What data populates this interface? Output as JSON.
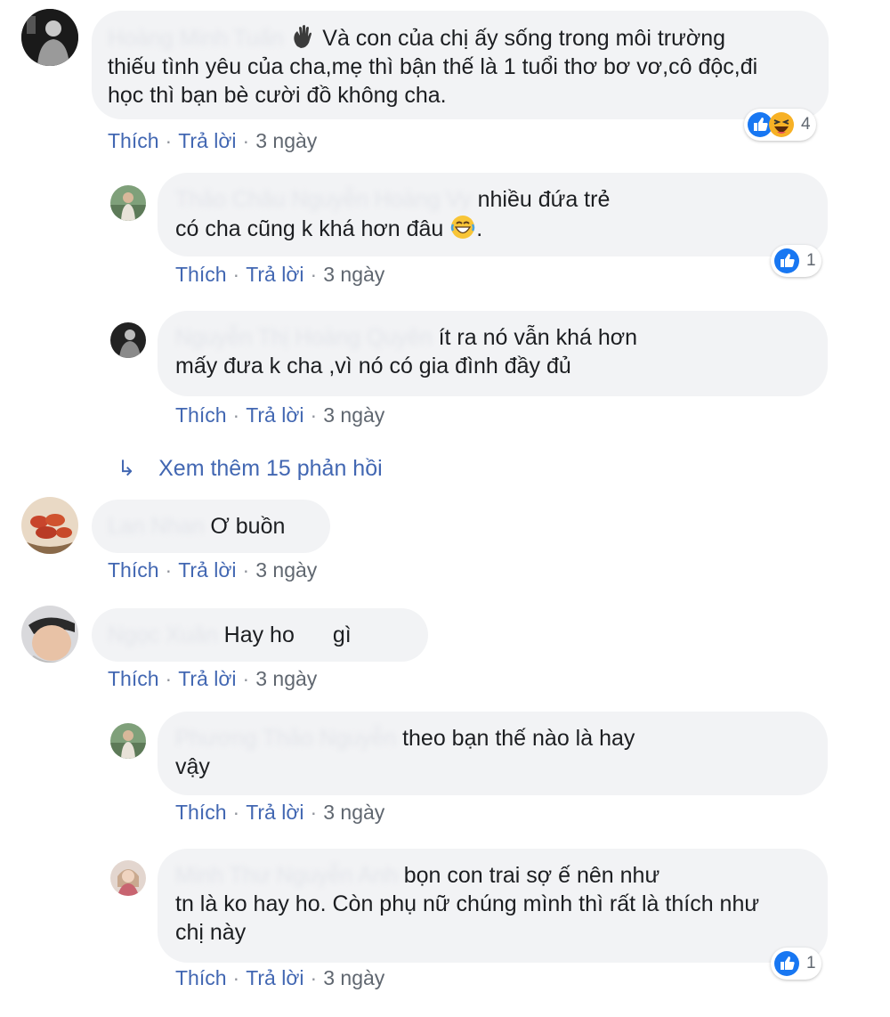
{
  "comments": [
    {
      "id": "c1",
      "author": "Hoàng Minh Tuấn",
      "lines": [
        "Và con của chị ấy sống trong môi trường",
        "thiếu tình yêu của cha,mẹ thì bận thế là 1 tuổi thơ bơ vơ,cô độc,đi",
        "học thì bạn bè cười đồ không cha."
      ],
      "like_label": "Thích",
      "reply_label": "Trả lời",
      "time": "3 ngày",
      "reactions": [
        "like-icon",
        "haha-icon"
      ],
      "reaction_count": "4"
    },
    {
      "id": "c1r1",
      "author": "Thảo Châu Nguyễn Hoàng Vy",
      "lines": [
        "nhiều đứa trẻ",
        "có cha cũng k khá hơn đâu",
        "."
      ],
      "like_label": "Thích",
      "reply_label": "Trả lời",
      "time": "3 ngày",
      "reactions": [
        "like-icon"
      ],
      "reaction_count": "1"
    },
    {
      "id": "c1r2",
      "author": "Nguyễn Thị Hoàng Quyên",
      "lines": [
        "ít ra nó vẫn khá hơn",
        "mấy đưa k cha ,vì nó có gia đình đầy đủ"
      ],
      "like_label": "Thích",
      "reply_label": "Trả lời",
      "time": "3 ngày"
    },
    {
      "id": "c2",
      "author": "Lan Nhan",
      "lines": [
        "Ơ buồn"
      ],
      "like_label": "Thích",
      "reply_label": "Trả lời",
      "time": "3 ngày"
    },
    {
      "id": "c3",
      "author": "Ngọc Xuân",
      "lines": [
        "Hay ho",
        "gì"
      ],
      "like_label": "Thích",
      "reply_label": "Trả lời",
      "time": "3 ngày"
    },
    {
      "id": "c3r1",
      "author": "Phương Thảo Nguyễn",
      "lines": [
        "theo bạn thế nào là hay",
        "vậy"
      ],
      "like_label": "Thích",
      "reply_label": "Trả lời",
      "time": "3 ngày"
    },
    {
      "id": "c3r2",
      "author": "Minh Thư Nguyễn Anh",
      "lines": [
        "bọn con trai sợ ế nên như",
        "tn là ko hay ho. Còn phụ nữ chúng mình thì rất là thích như",
        "chị này"
      ],
      "like_label": "Thích",
      "reply_label": "Trả lời",
      "time": "3 ngày",
      "reactions": [
        "like-icon"
      ],
      "reaction_count": "1"
    }
  ],
  "view_more": {
    "label": "Xem thêm 15 phản hồi",
    "icon": "reply-arrow-icon"
  },
  "colors": {
    "link": "#4267b2",
    "bubble": "#f2f3f5",
    "like": "#1877f2",
    "haha": "#f7b125"
  },
  "emojis": {
    "wave": "wave-hand-icon",
    "laugh": "laughing-icon"
  }
}
